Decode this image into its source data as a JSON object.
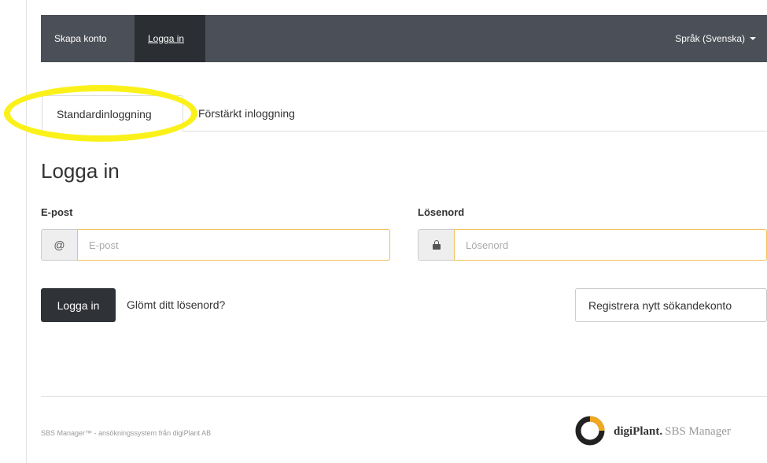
{
  "navbar": {
    "create_account": "Skapa konto",
    "login": "Logga in",
    "language": "Språk (Svenska)"
  },
  "tabs": {
    "standard": "Standardinloggning",
    "reinforced": "Förstärkt inloggning"
  },
  "title": "Logga in",
  "form": {
    "email_label": "E-post",
    "email_icon": "@",
    "email_placeholder": "E-post",
    "email_value": "",
    "password_label": "Lösenord",
    "password_placeholder": "Lösenord",
    "password_value": ""
  },
  "actions": {
    "login_button": "Logga in",
    "forgot_password": "Glömt ditt lösenord?",
    "register_button": "Registrera nytt sökandekonto"
  },
  "footer": {
    "text": "SBS Manager™ - ansökningssystem från digiPlant AB",
    "brand_name": "digiPlant.",
    "brand_product": "SBS Manager"
  },
  "colors": {
    "navbar_bg": "#4b4f57",
    "navbar_active": "#2b2e33",
    "highlight": "#fbf11a",
    "input_focus_border": "#f0c060",
    "button_dark": "#2f3237",
    "logo_accent": "#f0a81e"
  },
  "icons": {
    "email": "at-icon",
    "password": "lock-icon",
    "language": "caret-down-icon"
  }
}
